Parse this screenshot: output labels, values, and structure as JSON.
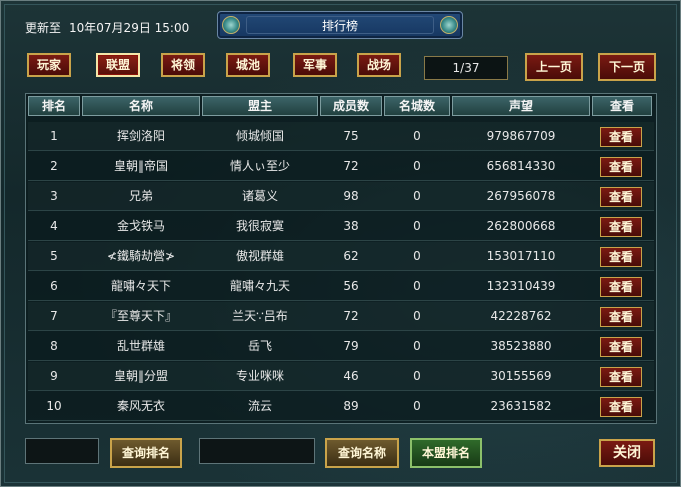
{
  "header": {
    "update_label": "更新至",
    "update_value": "10年07月29日 15:00",
    "title": "排行榜"
  },
  "tabs": [
    "玩家",
    "联盟",
    "将领",
    "城池",
    "军事",
    "战场"
  ],
  "active_tab": "联盟",
  "pagination": {
    "indicator": "1/37",
    "prev_label": "上一页",
    "next_label": "下一页"
  },
  "table": {
    "headers": [
      "排名",
      "名称",
      "盟主",
      "成员数",
      "名城数",
      "声望",
      "查看"
    ],
    "view_label": "查看",
    "rows": [
      {
        "rank": "1",
        "name": "挥剑洛阳",
        "leader": "倾城倾国",
        "members": "75",
        "cities": "0",
        "prestige": "979867709"
      },
      {
        "rank": "2",
        "name": "皇朝‖帝国",
        "leader": "情人ぃ至少",
        "members": "72",
        "cities": "0",
        "prestige": "656814330"
      },
      {
        "rank": "3",
        "name": "兄弟",
        "leader": "诸葛义",
        "members": "98",
        "cities": "0",
        "prestige": "267956078"
      },
      {
        "rank": "4",
        "name": "金戈铁马",
        "leader": "我很寂寞",
        "members": "38",
        "cities": "0",
        "prestige": "262800668"
      },
      {
        "rank": "5",
        "name": "≮鐵騎劫營≯",
        "leader": "傲视群雄",
        "members": "62",
        "cities": "0",
        "prestige": "153017110"
      },
      {
        "rank": "6",
        "name": "龍嘯々天下",
        "leader": "龍嘯々九天",
        "members": "56",
        "cities": "0",
        "prestige": "132310439"
      },
      {
        "rank": "7",
        "name": "『至尊天下』",
        "leader": "兰天∵吕布",
        "members": "72",
        "cities": "0",
        "prestige": "42228762"
      },
      {
        "rank": "8",
        "name": "乱世群雄",
        "leader": "岳飞",
        "members": "79",
        "cities": "0",
        "prestige": "38523880"
      },
      {
        "rank": "9",
        "name": "皇朝‖分盟",
        "leader": "专业咪咪",
        "members": "46",
        "cities": "0",
        "prestige": "30155569"
      },
      {
        "rank": "10",
        "name": "秦风无衣",
        "leader": "流云",
        "members": "89",
        "cities": "0",
        "prestige": "23631582"
      }
    ]
  },
  "footer": {
    "query_rank_label": "查询排名",
    "query_name_label": "查询名称",
    "own_rank_label": "本盟排名",
    "close_label": "关闭"
  }
}
